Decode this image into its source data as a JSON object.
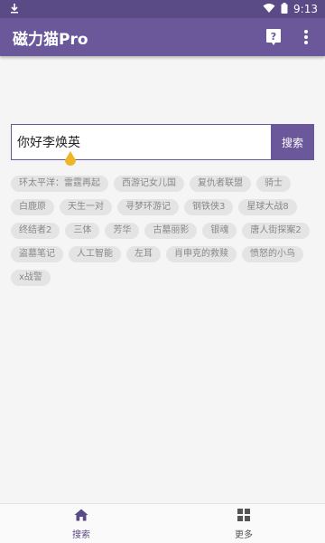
{
  "status_bar": {
    "time": "9:13",
    "download_icon": "download-icon",
    "wifi_icon": "wifi-icon",
    "battery_icon": "battery-icon"
  },
  "app_bar": {
    "title": "磁力猫Pro",
    "help_icon": "help-icon",
    "more_icon": "more-vertical-icon"
  },
  "search": {
    "value": "你好李焕英",
    "button_label": "搜索"
  },
  "tags": [
    "环太平洋：雷霆再起",
    "西游记女儿国",
    "复仇者联盟",
    "骑士",
    "白鹿原",
    "天生一对",
    "寻梦环游记",
    "钢铁侠3",
    "星球大战8",
    "终结者2",
    "三体",
    "芳华",
    "古墓丽影",
    "银魂",
    "唐人街探案2",
    "盗墓笔记",
    "人工智能",
    "左耳",
    "肖申克的救赎",
    "愤怒的小鸟",
    "x战警"
  ],
  "bottom_nav": {
    "items": [
      {
        "label": "搜索",
        "icon": "home-icon",
        "active": true
      },
      {
        "label": "更多",
        "icon": "grid-icon",
        "active": false
      }
    ]
  },
  "colors": {
    "primary": "#6a589a",
    "primary_dark": "#5a4a86",
    "accent": "#f0b428",
    "tag_bg": "#e4e4e4",
    "tag_text": "#888888"
  }
}
